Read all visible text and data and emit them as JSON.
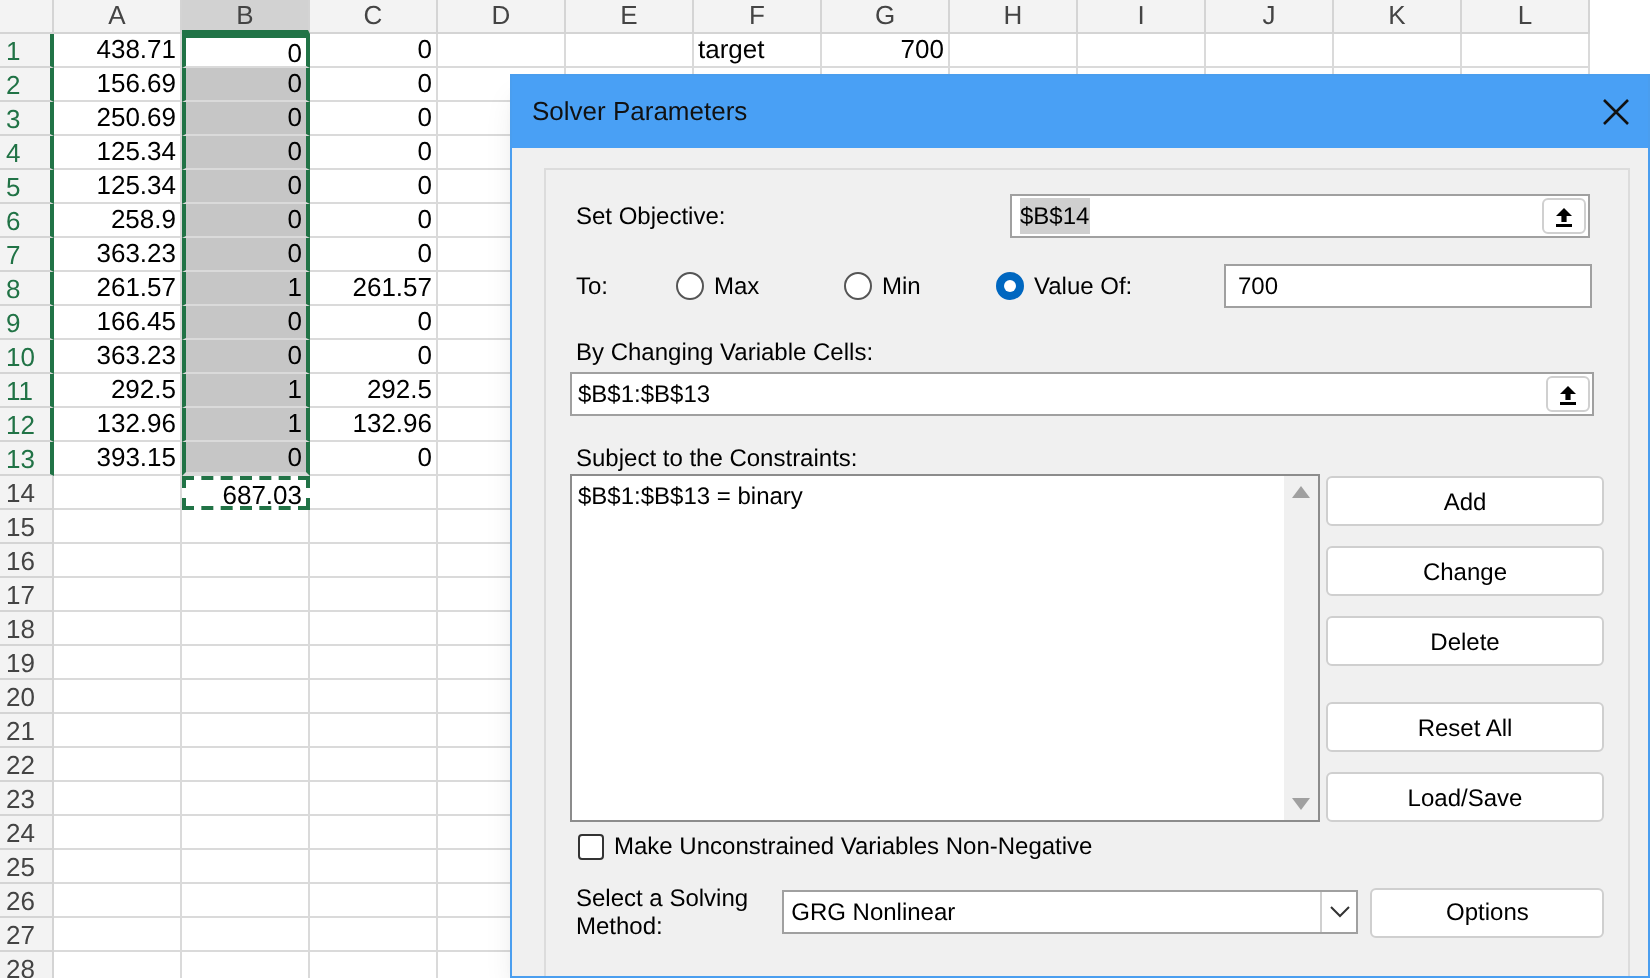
{
  "sheet": {
    "columns": [
      {
        "label": "A",
        "selected": false
      },
      {
        "label": "B",
        "selected": true
      },
      {
        "label": "C",
        "selected": false
      },
      {
        "label": "D",
        "selected": false
      },
      {
        "label": "E",
        "selected": false
      },
      {
        "label": "F",
        "selected": false
      },
      {
        "label": "G",
        "selected": false
      },
      {
        "label": "H",
        "selected": false
      },
      {
        "label": "I",
        "selected": false
      },
      {
        "label": "J",
        "selected": false
      },
      {
        "label": "K",
        "selected": false
      },
      {
        "label": "L",
        "selected": false
      }
    ],
    "rows": [
      {
        "label": "1",
        "kind": "active",
        "cells": {
          "a": "438.71",
          "b": "0",
          "c": "0",
          "f": "target",
          "g": "700"
        }
      },
      {
        "label": "2",
        "kind": "selected",
        "cells": {
          "a": "156.69",
          "b": "0",
          "c": "0"
        }
      },
      {
        "label": "3",
        "kind": "selected",
        "cells": {
          "a": "250.69",
          "b": "0",
          "c": "0"
        }
      },
      {
        "label": "4",
        "kind": "selected",
        "cells": {
          "a": "125.34",
          "b": "0",
          "c": "0"
        }
      },
      {
        "label": "5",
        "kind": "selected",
        "cells": {
          "a": "125.34",
          "b": "0",
          "c": "0"
        }
      },
      {
        "label": "6",
        "kind": "selected",
        "cells": {
          "a": "258.9",
          "b": "0",
          "c": "0"
        }
      },
      {
        "label": "7",
        "kind": "selected",
        "cells": {
          "a": "363.23",
          "b": "0",
          "c": "0"
        }
      },
      {
        "label": "8",
        "kind": "selected",
        "cells": {
          "a": "261.57",
          "b": "1",
          "c": "261.57"
        }
      },
      {
        "label": "9",
        "kind": "selected",
        "cells": {
          "a": "166.45",
          "b": "0",
          "c": "0"
        }
      },
      {
        "label": "10",
        "kind": "selected",
        "cells": {
          "a": "363.23",
          "b": "0",
          "c": "0"
        }
      },
      {
        "label": "11",
        "kind": "selected",
        "cells": {
          "a": "292.5",
          "b": "1",
          "c": "292.5"
        }
      },
      {
        "label": "12",
        "kind": "selected",
        "cells": {
          "a": "132.96",
          "b": "1",
          "c": "132.96"
        }
      },
      {
        "label": "13",
        "kind": "selected",
        "cells": {
          "a": "393.15",
          "b": "0",
          "c": "0"
        }
      },
      {
        "label": "14",
        "kind": "copied",
        "cells": {
          "b": "687.03"
        }
      },
      {
        "label": "15",
        "kind": "plain"
      },
      {
        "label": "16",
        "kind": "plain"
      },
      {
        "label": "17",
        "kind": "plain"
      },
      {
        "label": "18",
        "kind": "plain"
      },
      {
        "label": "19",
        "kind": "plain"
      },
      {
        "label": "20",
        "kind": "plain"
      },
      {
        "label": "21",
        "kind": "plain"
      },
      {
        "label": "22",
        "kind": "plain"
      },
      {
        "label": "23",
        "kind": "plain"
      },
      {
        "label": "24",
        "kind": "plain"
      },
      {
        "label": "25",
        "kind": "plain"
      },
      {
        "label": "26",
        "kind": "plain"
      },
      {
        "label": "27",
        "kind": "plain"
      },
      {
        "label": "28",
        "kind": "plain"
      }
    ]
  },
  "dialog": {
    "title": "Solver Parameters",
    "objective": {
      "label": "Set Objective:",
      "value": "$B$14"
    },
    "to": {
      "label": "To:",
      "options": [
        {
          "label": "Max",
          "selected": false
        },
        {
          "label": "Min",
          "selected": false
        },
        {
          "label": "Value Of:",
          "selected": true
        }
      ],
      "value": "700"
    },
    "changing": {
      "label": "By Changing Variable Cells:",
      "value": "$B$1:$B$13"
    },
    "constraints": {
      "label": "Subject to the Constraints:",
      "items": [
        "$B$1:$B$13 = binary"
      ]
    },
    "buttons": [
      "Add",
      "Change",
      "Delete",
      "Reset All",
      "Load/Save"
    ],
    "nonnegative": {
      "label": "Make Unconstrained Variables Non-Negative",
      "checked": false
    },
    "method": {
      "label": "Select a Solving Method:",
      "value": "GRG Nonlinear"
    },
    "options_button": "Options"
  }
}
